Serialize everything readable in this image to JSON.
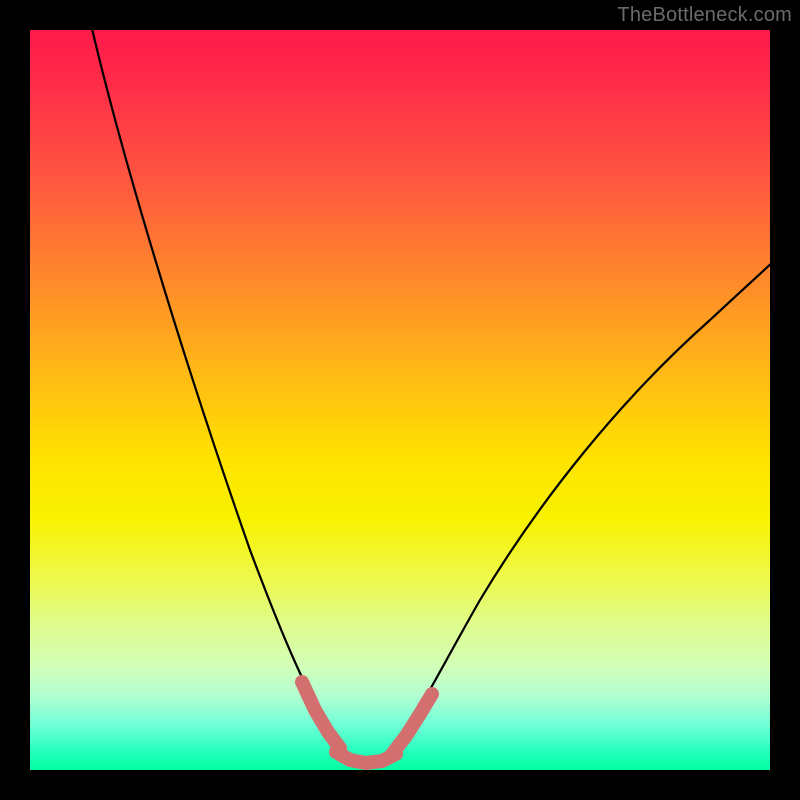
{
  "watermark": "TheBottleneck.com",
  "colors": {
    "curve": "#000000",
    "accent": "#d46f6f",
    "gradient_top": "#ff1a4a",
    "gradient_bottom": "#00ffa2",
    "frame": "#000000"
  },
  "chart_data": {
    "type": "line",
    "title": "",
    "xlabel": "",
    "ylabel": "",
    "xlim": [
      0,
      100
    ],
    "ylim": [
      0,
      100
    ],
    "grid": false,
    "legend": false,
    "series": [
      {
        "name": "left-branch",
        "x": [
          8,
          12,
          16,
          20,
          24,
          28,
          30,
          32,
          34,
          36,
          38,
          40,
          42
        ],
        "y": [
          100,
          88,
          76,
          64,
          52,
          38,
          30,
          22,
          15,
          10,
          6,
          3,
          1
        ]
      },
      {
        "name": "valley-floor",
        "x": [
          42,
          44,
          46,
          48
        ],
        "y": [
          1,
          0.5,
          0.5,
          1
        ]
      },
      {
        "name": "right-branch",
        "x": [
          48,
          52,
          56,
          60,
          66,
          72,
          80,
          88,
          96,
          100
        ],
        "y": [
          1,
          5,
          11,
          18,
          27,
          36,
          48,
          58,
          67,
          71
        ]
      },
      {
        "name": "accent-left",
        "x": [
          35,
          37,
          39,
          41
        ],
        "y": [
          10,
          6,
          3,
          2
        ]
      },
      {
        "name": "accent-floor",
        "x": [
          41,
          43,
          45,
          47,
          49
        ],
        "y": [
          2,
          1,
          1,
          1,
          2
        ]
      },
      {
        "name": "accent-right",
        "x": [
          49,
          51,
          53
        ],
        "y": [
          2,
          5,
          9
        ]
      }
    ]
  }
}
